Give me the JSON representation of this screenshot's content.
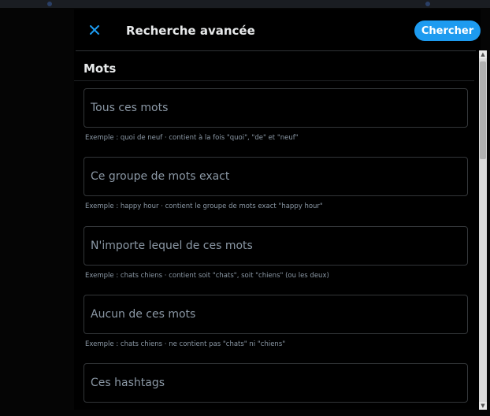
{
  "header": {
    "close_icon": "close-icon",
    "title": "Recherche avancée",
    "search_label": "Chercher"
  },
  "colors": {
    "accent": "#1d9bf0",
    "background": "#000000",
    "border": "#333639",
    "muted_text": "#8b98a5"
  },
  "section": {
    "title": "Mots",
    "fields": [
      {
        "placeholder": "Tous ces mots",
        "value": "",
        "hint": "Exemple : quoi de neuf · contient à la fois \"quoi\", \"de\" et \"neuf\""
      },
      {
        "placeholder": "Ce groupe de mots exact",
        "value": "",
        "hint": "Exemple : happy hour · contient le groupe de mots exact \"happy hour\""
      },
      {
        "placeholder": "N'importe lequel de ces mots",
        "value": "",
        "hint": "Exemple : chats chiens · contient soit \"chats\", soit \"chiens\" (ou les deux)"
      },
      {
        "placeholder": "Aucun de ces mots",
        "value": "",
        "hint": "Exemple : chats chiens · ne contient pas \"chats\" ni \"chiens\""
      },
      {
        "placeholder": "Ces hashtags",
        "value": ""
      }
    ]
  },
  "scrollbar": {
    "up_icon": "scroll-up-arrow-icon",
    "down_icon": "scroll-down-arrow-icon",
    "up_glyph": "▲",
    "down_glyph": "▼",
    "scroll_position": 0.0
  }
}
